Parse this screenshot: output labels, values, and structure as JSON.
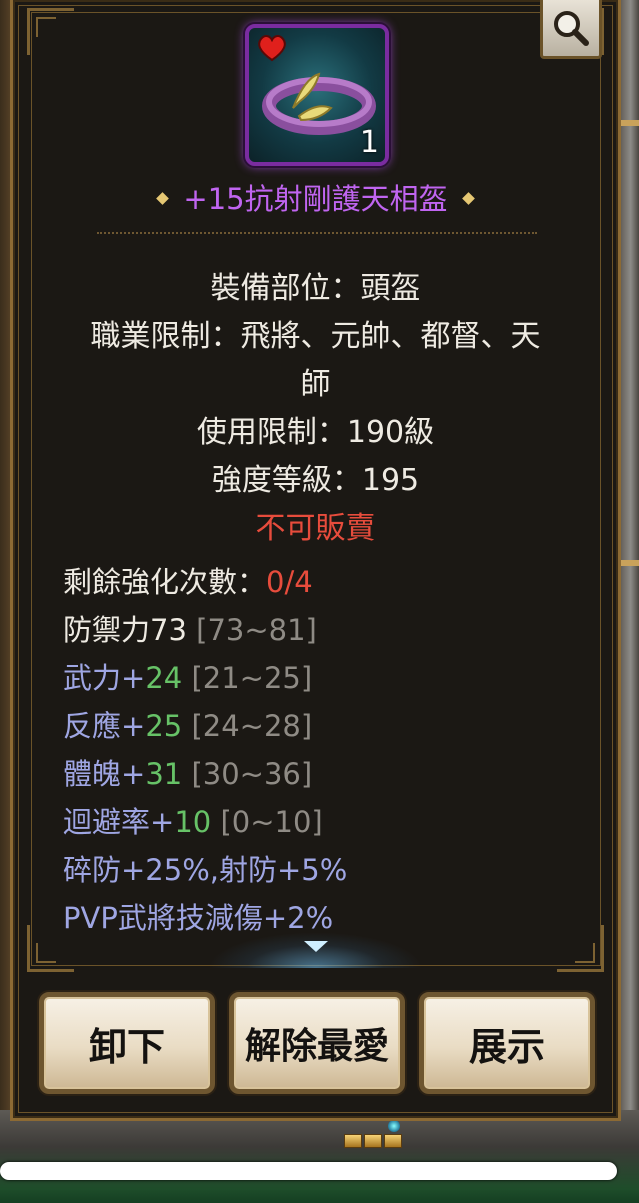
{
  "item": {
    "name": "+15抗射剛護天相盔",
    "count": "1",
    "name_color": "#c065f0"
  },
  "info_lines": [
    "裝備部位：頭盔",
    "職業限制：飛將、元帥、都督、天",
    "師",
    "使用限制：190級",
    "強度等級：195"
  ],
  "sell_status": "不可販賣",
  "enhance": {
    "label": "剩餘強化次數：",
    "value": "0/4"
  },
  "defense": {
    "label": "防禦力73",
    "range": "[73~81]"
  },
  "stats": [
    {
      "label": "武力+",
      "value": "24",
      "range": "[21~25]"
    },
    {
      "label": "反應+",
      "value": "25",
      "range": "[24~28]"
    },
    {
      "label": "體魄+",
      "value": "31",
      "range": "[30~36]"
    },
    {
      "label": "迴避率+",
      "value": "10",
      "range": "[0~10]"
    }
  ],
  "extra_stats": [
    "碎防+25%,射防+5%",
    "PVP武將技減傷+2%"
  ],
  "buttons": {
    "unequip": "卸下",
    "unfavorite": "解除最愛",
    "show": "展示"
  },
  "colors": {
    "accent_gold": "#8c6a34",
    "red": "#e74c3c",
    "stat_label": "#9fa6e3",
    "stat_value": "#67c267",
    "range_gray": "#8f8b85"
  }
}
